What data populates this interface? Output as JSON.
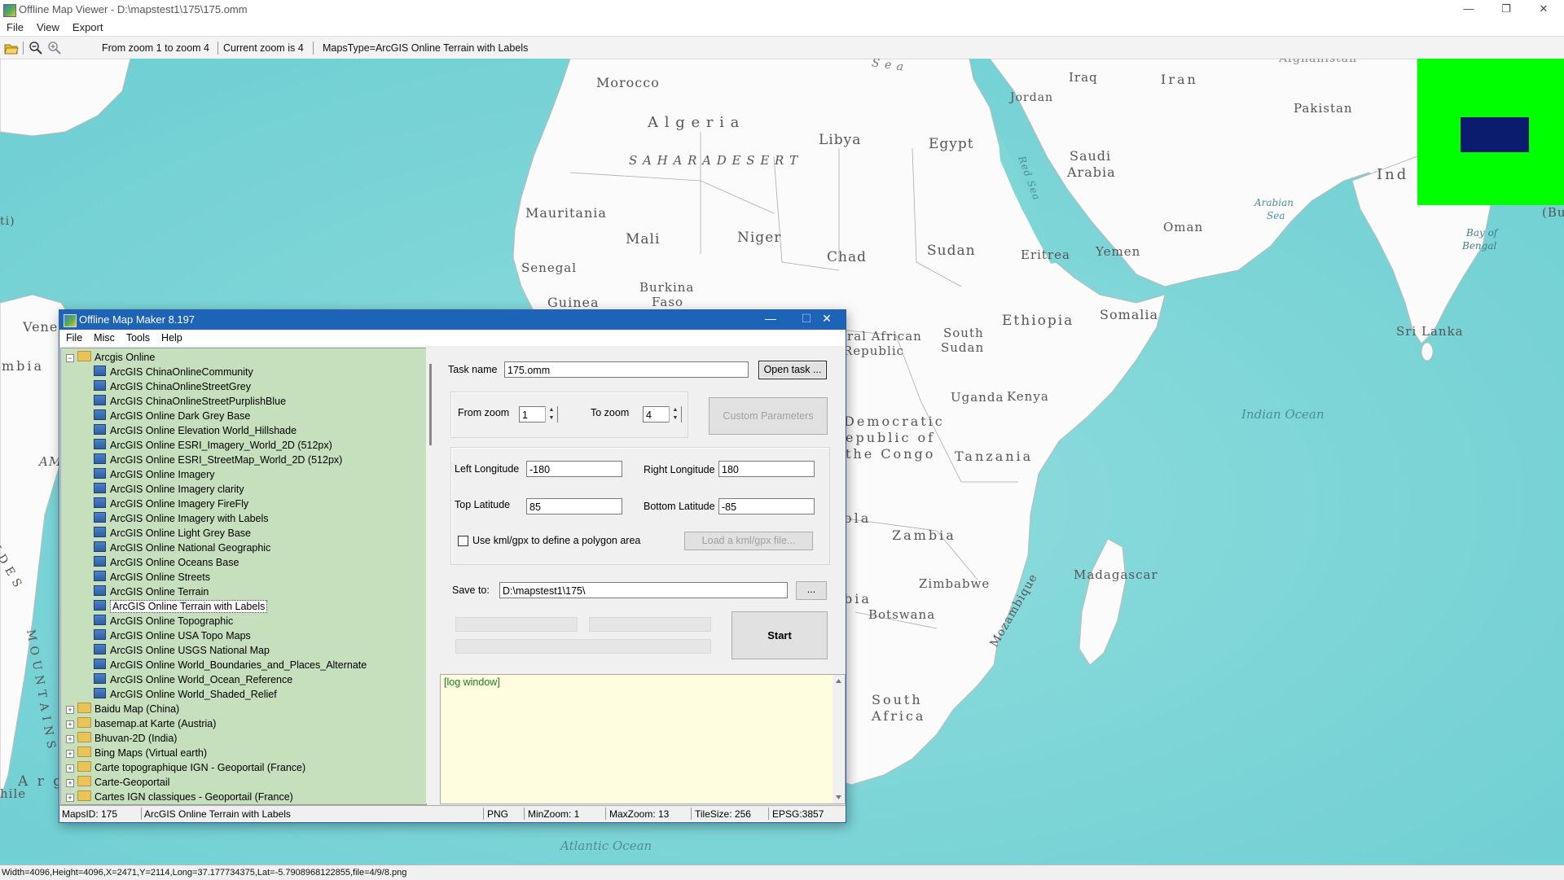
{
  "window": {
    "title": "Offline Map Viewer - D:\\mapstest1\\175\\175.omm",
    "controls": {
      "minimize": "—",
      "maximize": "❐",
      "close": "✕"
    }
  },
  "menu": [
    "File",
    "View",
    "Export"
  ],
  "toolbar": {
    "zoom_range": "From zoom 1 to zoom 4",
    "current_zoom": "Current zoom is 4",
    "maps_type": "MapsType=ArcGIS Online Terrain with Labels"
  },
  "map_labels": {
    "sea": "S e a",
    "morocco": "Morocco",
    "algeria": "A l g e r i a",
    "sahara": "S  A  H  A  R  A    D  E  S  E  R  T",
    "libya": "Libya",
    "egypt": "Egypt",
    "iraq": "Iraq",
    "iran": "Iran",
    "jordan": "Jordan",
    "afghanistan": "Afghanistan",
    "pakistan": "Pakistan",
    "saudi": "Saudi",
    "arabia": "Arabia",
    "ind": "Ind",
    "red_sea": "Red Sea",
    "mauritania": "Mauritania",
    "mali": "Mali",
    "niger": "Niger",
    "chad": "Chad",
    "sudan": "Sudan",
    "eritrea": "Eritrea",
    "yemen": "Yemen",
    "oman": "Oman",
    "arabian_sea_1": "Arabian",
    "arabian_sea_2": "Sea",
    "bay_bengal_1": "Bay of",
    "bay_bengal_2": "Bengal",
    "bu": "(Bu",
    "senegal": "Senegal",
    "burkina_1": "Burkina",
    "burkina_2": "Faso",
    "guinea": "Guinea",
    "somalia": "Somalia",
    "ethiopia": "Ethiopia",
    "south_sudan_1": "South",
    "south_sudan_2": "Sudan",
    "central_african_1": "tral African",
    "central_african_2": "Republic",
    "sri_lanka": "Sri Lanka",
    "uganda": "Uganda",
    "kenya": "Kenya",
    "indian_ocean": "Indian Ocean",
    "drc_1": "Democratic",
    "drc_2": "epublic of",
    "drc_3": "the Congo",
    "tanzania": "Tanzania",
    "ola": "ola",
    "zambia": "Zambia",
    "madagascar": "Madagascar",
    "zimbabwe": "Zimbabwe",
    "mozambique": "Mozambique",
    "bia": "bia",
    "botswana": "Botswana",
    "south_africa_1": "South",
    "south_africa_2": "Africa",
    "atlantic_ocean": "Atlantic Ocean",
    "vene": "Vene",
    "mbia": "mbia",
    "am": "AM",
    "ti": "ti)",
    "andes": "N D E S",
    "mountains": "M O U N T A I N S",
    "arg": "A r g",
    "hile": "hile"
  },
  "statusbar": "Width=4096,Height=4096,X=2471,Y=2114,Long=37.177734375,Lat=-5.7908968122855,file=4/9/8.png",
  "dialog": {
    "title": "Offline Map Maker 8.197",
    "menu": [
      "File",
      "Misc",
      "Tools",
      "Help"
    ],
    "tree": {
      "root": "Arcgis Online",
      "items": [
        "ArcGIS ChinaOnlineCommunity",
        "ArcGIS ChinaOnlineStreetGrey",
        "ArcGIS ChinaOnlineStreetPurplishBlue",
        "ArcGIS Online Dark Grey Base",
        "ArcGIS Online Elevation World_Hillshade",
        "ArcGIS Online ESRI_Imagery_World_2D (512px)",
        "ArcGIS Online ESRI_StreetMap_World_2D (512px)",
        "ArcGIS Online Imagery",
        "ArcGIS Online Imagery clarity",
        "ArcGIS Online Imagery FireFly",
        "ArcGIS Online Imagery with Labels",
        "ArcGIS Online Light Grey Base",
        "ArcGIS Online National Geographic",
        "ArcGIS Online Oceans Base",
        "ArcGIS Online Streets",
        "ArcGIS Online Terrain",
        "ArcGIS Online Terrain with Labels",
        "ArcGIS Online Topographic",
        "ArcGIS Online USA Topo Maps",
        "ArcGIS Online USGS National Map",
        "ArcGIS Online World_Boundaries_and_Places_Alternate",
        "ArcGIS Online World_Ocean_Reference",
        "ArcGIS Online World_Shaded_Relief"
      ],
      "selected_index": 16,
      "folders": [
        "Baidu Map (China)",
        "basemap.at Karte (Austria)",
        "Bhuvan-2D (India)",
        "Bing Maps (Virtual earth)",
        "Carte topographique IGN - Geoportail (France)",
        "Carte-Geoportail",
        "Cartes IGN classiques - Geoportail (France)"
      ],
      "expand_open": "−",
      "expand_closed": "+"
    },
    "task_name_label": "Task name",
    "task_name_value": "175.omm",
    "open_task_label": "Open task ...",
    "from_zoom_label": "From zoom",
    "from_zoom_value": "1",
    "to_zoom_label": "To zoom",
    "to_zoom_value": "4",
    "custom_params_label": "Custom Parameters",
    "left_lon_label": "Left Longitude",
    "left_lon_value": "-180",
    "right_lon_label": "Right Longitude",
    "right_lon_value": "180",
    "top_lat_label": "Top Latitude",
    "top_lat_value": "85",
    "bottom_lat_label": "Bottom Latitude",
    "bottom_lat_value": "-85",
    "kml_checkbox_label": "Use kml/gpx to define a polygon area",
    "load_kml_label": "Load a kml/gpx file...",
    "save_to_label": "Save to:",
    "save_to_value": "D:\\mapstest1\\175\\",
    "browse_label": "...",
    "start_label": "Start",
    "log_text": "[log window]",
    "status": {
      "maps_id": "MapsID: 175",
      "map_name": "ArcGIS Online Terrain with Labels",
      "format": "PNG",
      "min_zoom": "MinZoom: 1",
      "max_zoom": "MaxZoom: 13",
      "tile_size": "TileSize: 256",
      "epsg": "EPSG:3857"
    },
    "controls": {
      "minimize": "—",
      "maximize": "☐",
      "close": "✕"
    }
  },
  "colors": {
    "ocean": "#7fd6d6",
    "land": "#ffffff",
    "overview_bg": "#00ff00",
    "overview_viewport": "#0b1c6e",
    "tree_bg": "#c6dfbd",
    "log_bg": "#fffde0",
    "dialog_titlebar": "#1d63b8"
  }
}
